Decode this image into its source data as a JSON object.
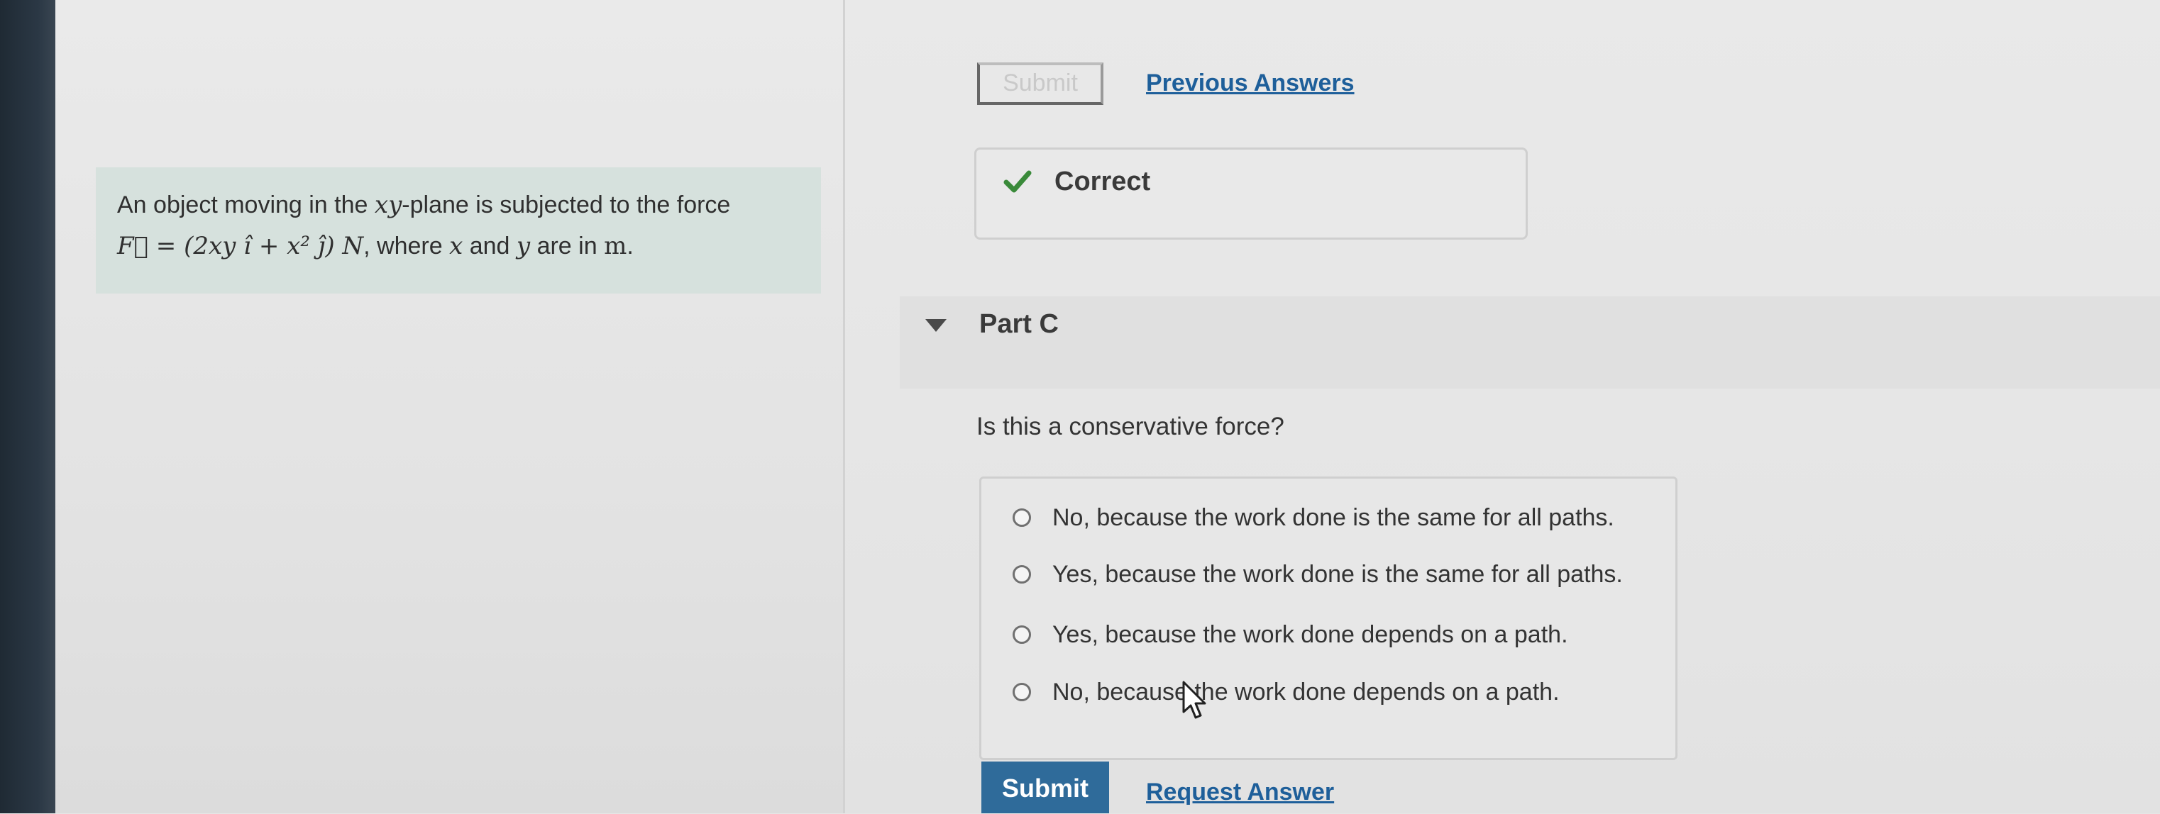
{
  "problem": {
    "line1_prefix": "An object moving in the ",
    "line1_var": "xy",
    "line1_suffix": "-plane is subjected to the force",
    "formula_force": "F⃗ = (2xy î + x² ĵ) N",
    "line2_middle": ", where ",
    "var_x": "x",
    "word_and": " and ",
    "var_y": "y",
    "line2_suffix": " are in ",
    "unit": "m",
    "period": "."
  },
  "previous_part": {
    "submit_label": "Submit",
    "previous_answers_label": "Previous Answers",
    "correct_label": "Correct",
    "check_icon": "check-icon"
  },
  "part_c": {
    "title": "Part C",
    "question": "Is this a conservative force?",
    "options": [
      "No, because the work done is the same for all paths.",
      "Yes, because the work done is the same for all paths.",
      "Yes, because the work done depends on a path.",
      "No, because the work done depends on a path."
    ],
    "submit_label": "Submit",
    "request_answer_label": "Request Answer"
  },
  "colors": {
    "accent": "#2f6b9a",
    "link": "#1e5f9a",
    "correct": "#3a8a3a",
    "problem_bg": "#d6e1dd"
  }
}
